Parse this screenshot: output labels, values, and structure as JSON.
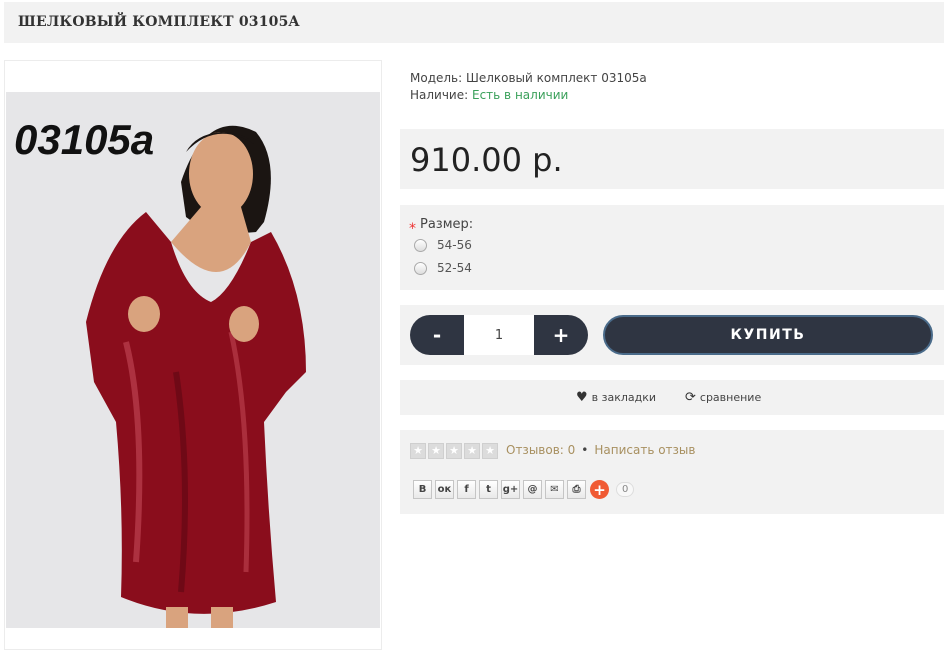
{
  "product": {
    "title": "ШЕЛКОВЫЙ КОМПЛЕКТ 03105A",
    "image_code": "03105a",
    "model_label": "Модель:",
    "model_value": "Шелковый комплект 03105а",
    "stock_label": "Наличие:",
    "stock_value": "Есть в наличии",
    "price": "910.00 р."
  },
  "options": {
    "size_label": "Размер:",
    "required_mark": "*",
    "sizes": [
      "54-56",
      "52-54"
    ]
  },
  "cart": {
    "minus": "-",
    "plus": "+",
    "quantity": "1",
    "buy_label": "КУПИТЬ"
  },
  "actions": {
    "wishlist": "в закладки",
    "compare": "сравнение"
  },
  "reviews": {
    "rating_stars": 0,
    "reviews_count": "Отзывов: 0",
    "separator": "•",
    "write_review": "Написать отзыв"
  },
  "share": {
    "buttons": [
      "В",
      "ok",
      "f",
      "t",
      "g+",
      "@",
      "mail",
      "print"
    ],
    "count": "0"
  },
  "colors": {
    "dark_button": "#2f3542",
    "in_stock": "#3aa05a",
    "review_link": "#a89060",
    "add_share": "#f05a33",
    "panel_bg": "#f2f2f2"
  }
}
